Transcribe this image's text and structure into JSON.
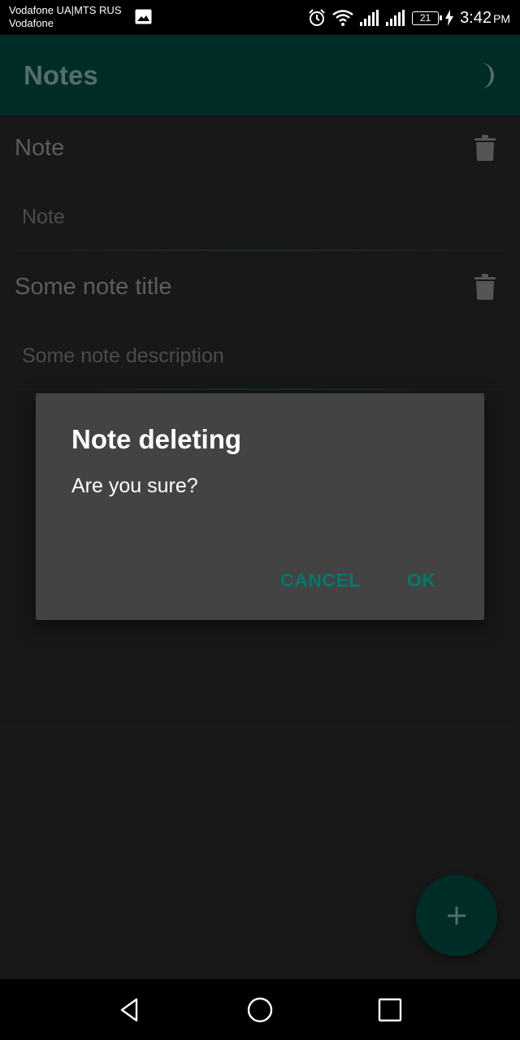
{
  "status_bar": {
    "carrier_line1": "Vodafone UA|MTS RUS",
    "carrier_line2": "Vodafone",
    "battery": "21",
    "time": "3:42",
    "ampm": "PM",
    "icons": [
      "gallery-icon",
      "alarm-icon",
      "wifi-icon",
      "signal-icon",
      "signal-icon",
      "battery-icon",
      "charging-icon"
    ]
  },
  "app_bar": {
    "title": "Notes",
    "theme_toggle_icon": "moon-icon"
  },
  "notes": [
    {
      "title": "Note",
      "description": "Note"
    },
    {
      "title": "Some note title",
      "description": "Some note description"
    }
  ],
  "dialog": {
    "title": "Note deleting",
    "message": "Are you sure?",
    "cancel_label": "CANCEL",
    "ok_label": "OK"
  },
  "fab": {
    "icon": "plus-icon"
  },
  "nav_bar": {
    "icons": [
      "back-icon",
      "home-icon",
      "recents-icon"
    ]
  },
  "colors": {
    "accent": "#00796b",
    "app_bar": "#00332e",
    "background": "#1c1c1c",
    "dialog": "#434343"
  }
}
